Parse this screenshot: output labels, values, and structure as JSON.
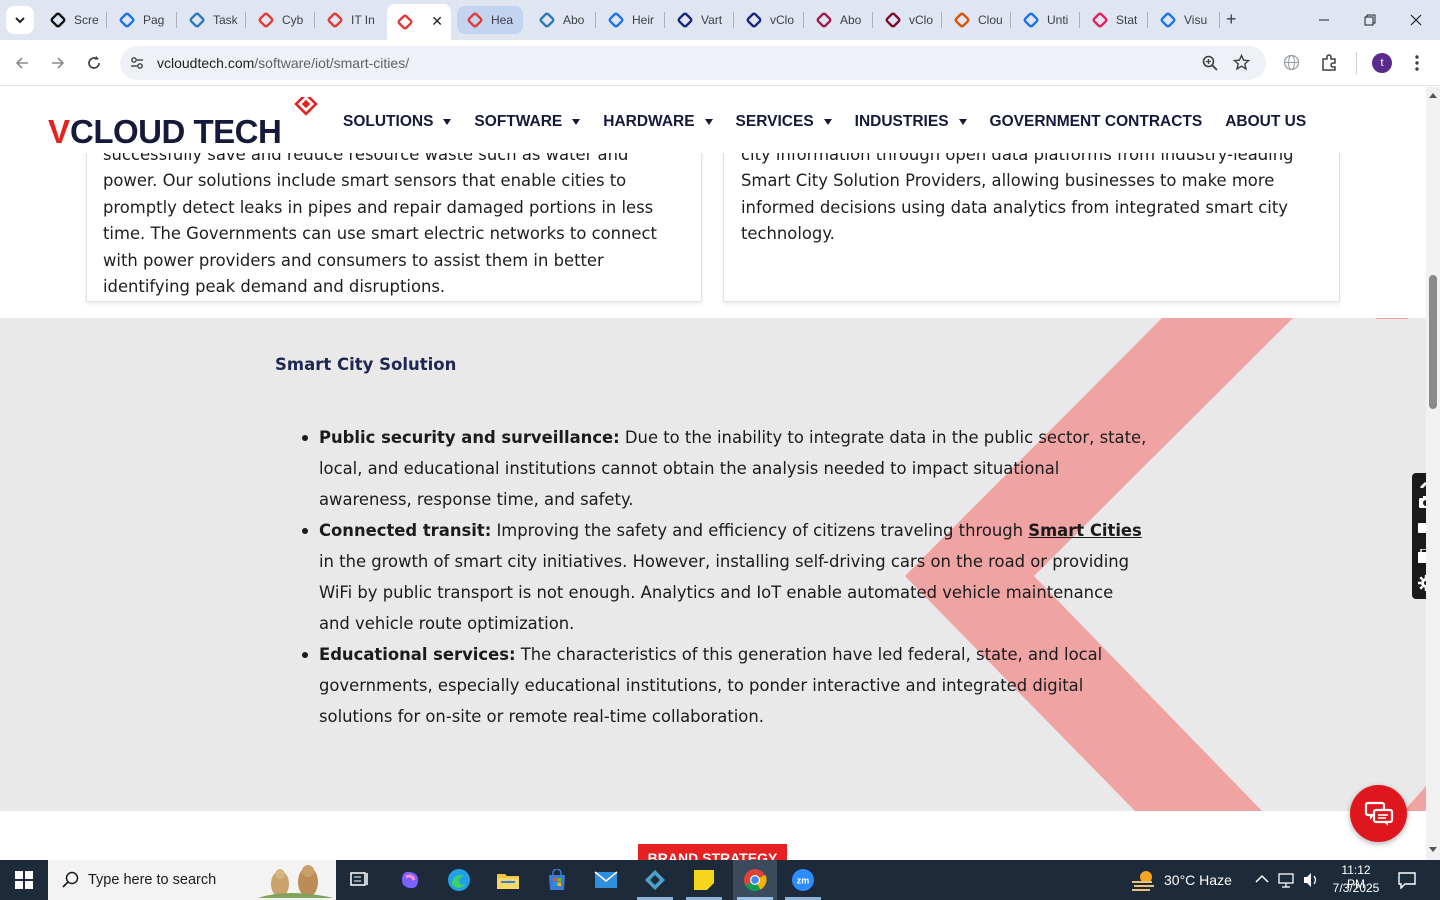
{
  "browser": {
    "tabs": [
      {
        "label": "Scre",
        "icon": "screenpal-icon",
        "color": "#111111"
      },
      {
        "label": "Pag",
        "icon": "pagespeed-icon",
        "color": "#1a73e8"
      },
      {
        "label": "Task",
        "icon": "taskmgr-icon",
        "color": "#2a7ab8"
      },
      {
        "label": "Cyb",
        "icon": "vcloud-diamond-icon",
        "color": "#e53935"
      },
      {
        "label": "IT In",
        "icon": "it-icon",
        "color": "#e53935"
      },
      {
        "label": "",
        "icon": "vcloud-diamond-icon",
        "color": "#e53935"
      },
      {
        "label": "Hea",
        "icon": "vcloud-diamond-icon",
        "color": "#e53935"
      },
      {
        "label": "Abo",
        "icon": "hex-icon",
        "color": "#2a7ab8"
      },
      {
        "label": "Heir",
        "icon": "heir-icon",
        "color": "#1a73e8"
      },
      {
        "label": "Vart",
        "icon": "x-icon",
        "color": "#1a237e"
      },
      {
        "label": "vClo",
        "icon": "check-icon",
        "color": "#1a237e"
      },
      {
        "label": "Abo",
        "icon": "ring-icon",
        "color": "#9c1c4c"
      },
      {
        "label": "vClo",
        "icon": "v-icon",
        "color": "#7a0c2e"
      },
      {
        "label": "Clou",
        "icon": "swoosh-icon",
        "color": "#e65100"
      },
      {
        "label": "Unti",
        "icon": "docs-icon",
        "color": "#1a73e8"
      },
      {
        "label": "Stat",
        "icon": "pen-icon",
        "color": "#e91e63"
      },
      {
        "label": "Visu",
        "icon": "pulse-icon",
        "color": "#1a73e8"
      }
    ],
    "url_host": "vcloudtech.com",
    "url_path": "/software/iot/smart-cities/"
  },
  "site": {
    "logo_text_a": "V",
    "logo_text_b": "CLOUD TECH",
    "menu": [
      {
        "label": "SOLUTIONS",
        "dropdown": true
      },
      {
        "label": "SOFTWARE",
        "dropdown": true
      },
      {
        "label": "HARDWARE",
        "dropdown": true
      },
      {
        "label": "SERVICES",
        "dropdown": true
      },
      {
        "label": "INDUSTRIES",
        "dropdown": true
      },
      {
        "label": "GOVERNMENT CONTRACTS",
        "dropdown": false
      },
      {
        "label": "ABOUT US",
        "dropdown": false
      }
    ],
    "card_left_text": "successfully save and reduce resource waste such as water and power. Our solutions include smart sensors that enable cities to promptly detect leaks in pipes and repair damaged portions in less time. The Governments can use smart electric networks to connect with power providers and consumers to assist them in better identifying peak demand and disruptions.",
    "card_right_text": "city information through open data platforms from industry-leading Smart City Solution Providers, allowing businesses to make more informed decisions using data analytics from integrated smart city technology.",
    "section_title": "Smart City Solution",
    "bullets": [
      {
        "bold": "Public security and surveillance:",
        "text": " Due to the inability to integrate data in the public sector, state, local, and educational institutions cannot obtain the analysis needed to impact situational awareness, response time, and safety.",
        "link": "",
        "after": ""
      },
      {
        "bold": "Connected transit:",
        "text": " Improving the safety and efficiency of citizens traveling through ",
        "link": "Smart Cities",
        "after": " in the growth of smart city initiatives. However, installing self-driving cars on the road or providing WiFi by public transport is not enough. Analytics and IoT enable automated vehicle maintenance and vehicle route optimization."
      },
      {
        "bold": "Educational services:",
        "text": " The characteristics of this generation have led federal, state, and local governments, especially educational institutions, to ponder interactive and integrated digital solutions for on-site or remote real-time collaboration.",
        "link": "",
        "after": ""
      }
    ],
    "brand_badge": "BRAND STRATEGY",
    "accent_color": "#e52121",
    "navy_color": "#15193a"
  },
  "taskbar": {
    "search_placeholder": "Type here to search",
    "weather": "30°C  Haze",
    "time": "11:12 PM",
    "date": "7/3/2025",
    "apps": [
      "task-view-icon",
      "copilot-icon",
      "edge-icon",
      "file-explorer-icon",
      "store-icon",
      "mail-icon",
      "app-icon",
      "sticky-notes-icon",
      "chrome-icon",
      "zoom-icon"
    ]
  }
}
